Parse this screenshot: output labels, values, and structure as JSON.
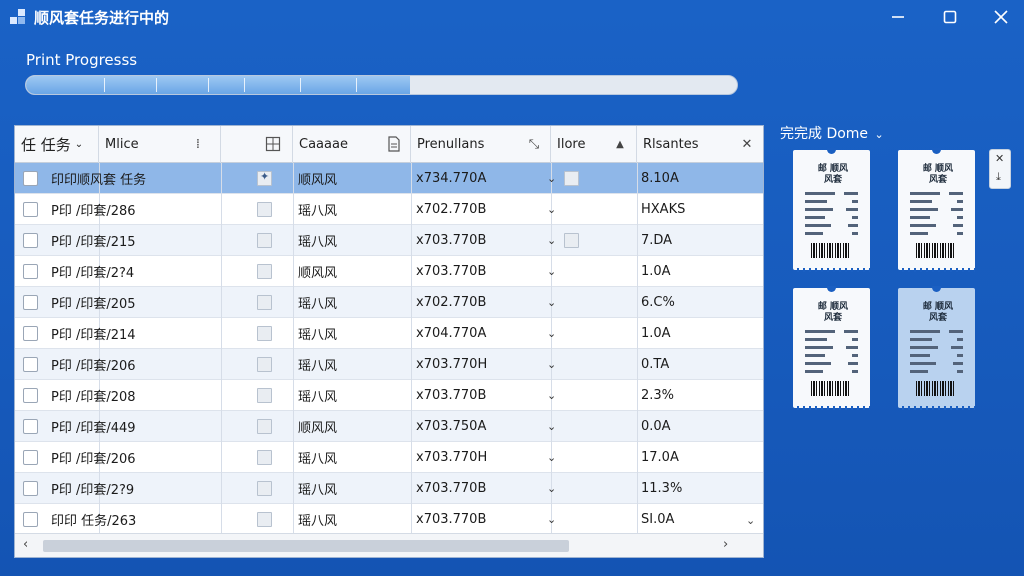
{
  "window": {
    "title": "顺风套任务进行中的"
  },
  "progress": {
    "label": "Print Progresss",
    "fraction": 0.54
  },
  "table": {
    "columns": [
      {
        "label": "任 任务"
      },
      {
        "label": "Mlice"
      },
      {
        "label": ""
      },
      {
        "label": "Caaaae"
      },
      {
        "label": "Prenullans"
      },
      {
        "label": "Ilore"
      },
      {
        "label": "Rlsantes"
      }
    ],
    "rows": [
      {
        "name": "印印顺风套 任务",
        "carrier": "顺风风",
        "amount": "x734.770A",
        "status": "8.10A",
        "checked2": true,
        "box3": true
      },
      {
        "name": "P印 /印套/286",
        "carrier": "瑶八风",
        "amount": "x702.770B",
        "status": "HXAKS",
        "checked2": false,
        "box3": false
      },
      {
        "name": "P印 /印套/215",
        "carrier": "瑶八风",
        "amount": "x703.770B",
        "status": "7.DA",
        "checked2": false,
        "box3": true
      },
      {
        "name": "P印 /印套/2?4",
        "carrier": "顺风风",
        "amount": "x703.770B",
        "status": "1.0A",
        "checked2": false,
        "box3": false
      },
      {
        "name": "P印 /印套/205",
        "carrier": "瑶八风",
        "amount": "x702.770B",
        "status": "6.C%",
        "checked2": false,
        "box3": false
      },
      {
        "name": "P印 /印套/214",
        "carrier": "瑶八风",
        "amount": "x704.770A",
        "status": "1.0A",
        "checked2": false,
        "box3": false
      },
      {
        "name": "P印 /印套/206",
        "carrier": "瑶八风",
        "amount": "x703.770H",
        "status": "0.TA",
        "checked2": false,
        "box3": false
      },
      {
        "name": "P印 /印套/208",
        "carrier": "瑶八风",
        "amount": "x703.770B",
        "status": "2.3%",
        "checked2": false,
        "box3": false
      },
      {
        "name": "P印 /印套/449",
        "carrier": "顺风风",
        "amount": "x703.750A",
        "status": "0.0A",
        "checked2": false,
        "box3": false
      },
      {
        "name": "P印 /印套/206",
        "carrier": "瑶八风",
        "amount": "x703.770H",
        "status": "17.0A",
        "checked2": false,
        "box3": false
      },
      {
        "name": "P印 /印套/2?9",
        "carrier": "瑶八风",
        "amount": "x703.770B",
        "status": "11.3%",
        "checked2": false,
        "box3": false
      },
      {
        "name": "印印 任务/263",
        "carrier": "瑶八风",
        "amount": "x703.770B",
        "status": "SI.0A",
        "checked2": false,
        "box3": false
      }
    ]
  },
  "preview": {
    "label": "完完成 Dome",
    "tickets": [
      {
        "header": "邮 顺风\n风套"
      },
      {
        "header": "邮 顺风\n风套"
      },
      {
        "header": "邮 顺风\n风套"
      },
      {
        "header": "邮 顺风\n风套"
      }
    ]
  },
  "colors": {
    "background": "#175bbd",
    "selected_row": "#8fb7e8",
    "progress_fill": "#6aa6e6"
  }
}
